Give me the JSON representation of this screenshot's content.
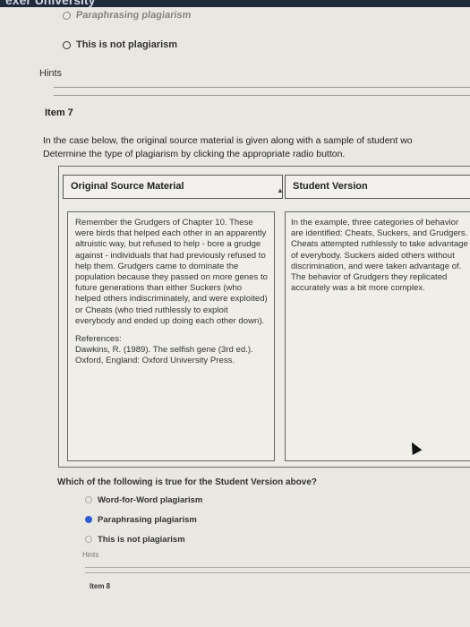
{
  "page": {
    "top_title_fragment": "exer University",
    "prev_option_paraphrasing": "Paraphrasing plagiarism",
    "prev_option_not": "This is not plagiarism",
    "hints_label": "Hints"
  },
  "item7": {
    "heading": "Item 7",
    "instruction_line1": "In the case below, the original source material is given along with a sample of student wo",
    "instruction_line2": "Determine the type of plagiarism by clicking the appropriate radio button.",
    "table": {
      "col_original": "Original Source Material",
      "col_student": "Student Version",
      "original_text": "Remember the Grudgers of Chapter 10. These were birds that helped each other in an apparently altruistic way, but refused to help - bore a grudge against - individuals that had previously refused to help them. Grudgers came to dominate the population because they passed on more genes to future generations than either Suckers (who helped others indiscriminately, and were exploited) or Cheats (who tried ruthlessly to exploit everybody and ended up doing each other down).",
      "references_label": "References:",
      "reference_text": "Dawkins, R. (1989). The selfish gene (3rd ed.). Oxford, England: Oxford University Press.",
      "student_text": "In the example, three categories of behavior are identified: Cheats, Suckers, and Grudgers. Cheats attempted ruthlessly to take advantage of everybody. Suckers aided others without discrimination, and were taken advantage of. The behavior of Grudgers they replicated accurately was a bit more complex."
    },
    "question": "Which of the following is true for the Student Version above?",
    "choices": [
      {
        "label": "Word-for-Word plagiarism",
        "selected": false
      },
      {
        "label": "Paraphrasing plagiarism",
        "selected": true
      },
      {
        "label": "This is not plagiarism",
        "selected": false
      }
    ],
    "hints_label": "Hints"
  },
  "item8": {
    "heading": "Item 8"
  },
  "colors": {
    "selected_radio": "#2f5bd3",
    "page_bg": "#e9e7e2"
  }
}
